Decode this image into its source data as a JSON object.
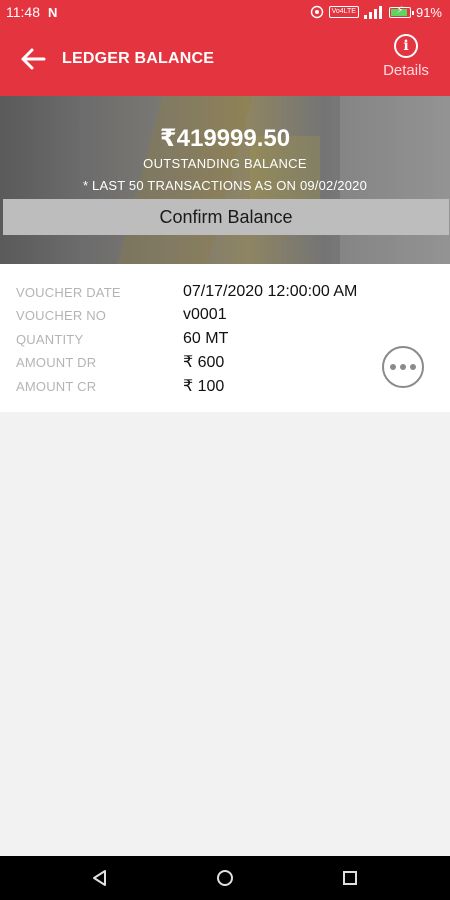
{
  "status_bar": {
    "time": "11:48",
    "notification_icon": "n-icon",
    "volte_label": "Vo4LTE",
    "battery_percent": "91%",
    "battery_level": 0.91
  },
  "app_bar": {
    "title": "LEDGER BALANCE",
    "back_icon": "arrow-left-icon",
    "details_icon": "info-icon",
    "details_icon_glyph": "i",
    "details_label": "Details"
  },
  "summary": {
    "balance": "₹419999.50",
    "balance_label": "OUTSTANDING BALANCE",
    "note": "* LAST 50 TRANSACTIONS AS ON 09/02/2020",
    "confirm_label": "Confirm Balance"
  },
  "transaction": {
    "fields": [
      {
        "label": "VOUCHER DATE",
        "value": "07/17/2020 12:00:00 AM"
      },
      {
        "label": "VOUCHER NO",
        "value": "v0001"
      },
      {
        "label": "QUANTITY",
        "value": "60 MT"
      },
      {
        "label": "AMOUNT DR",
        "value": "₹ 600"
      },
      {
        "label": "AMOUNT CR",
        "value": "₹ 100"
      }
    ],
    "more_icon": "more-horizontal-icon"
  },
  "nav_bar": {
    "back_icon": "triangle-back-icon",
    "home_icon": "circle-home-icon",
    "recents_icon": "square-recents-icon"
  },
  "colors": {
    "accent": "#e43440",
    "label_gray": "#b4b4b4",
    "button_gray": "#bdbdbd"
  }
}
